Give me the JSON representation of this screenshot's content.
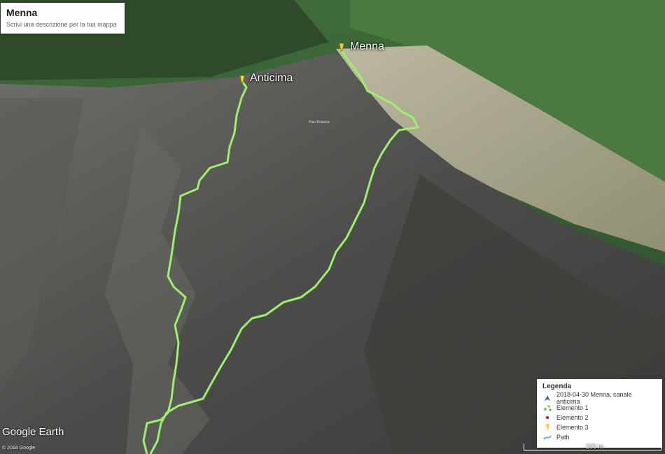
{
  "map": {
    "title": "Menna",
    "description": "Scrivi una descrizione per la tua mappa",
    "placemarks": [
      {
        "label": "Menna"
      },
      {
        "label": "Anticima"
      }
    ],
    "terrain_label": "Pian Rolarica",
    "logo": "Google Earth",
    "copyright": "© 2018 Google",
    "scale": "200 m",
    "track_color": "#9cf06a",
    "pin_color": "#f2d22e"
  },
  "legend": {
    "title": "Legenda",
    "items": [
      {
        "icon": "path-track-icon",
        "label": "2018-04-30 Menna, canale anticima"
      },
      {
        "icon": "element-icon",
        "label": "Elemento 1"
      },
      {
        "icon": "red-dot-icon",
        "label": "Elemento 2"
      },
      {
        "icon": "yellow-pin-icon",
        "label": "Elemento 3"
      },
      {
        "icon": "path-icon",
        "label": "Path"
      }
    ]
  }
}
